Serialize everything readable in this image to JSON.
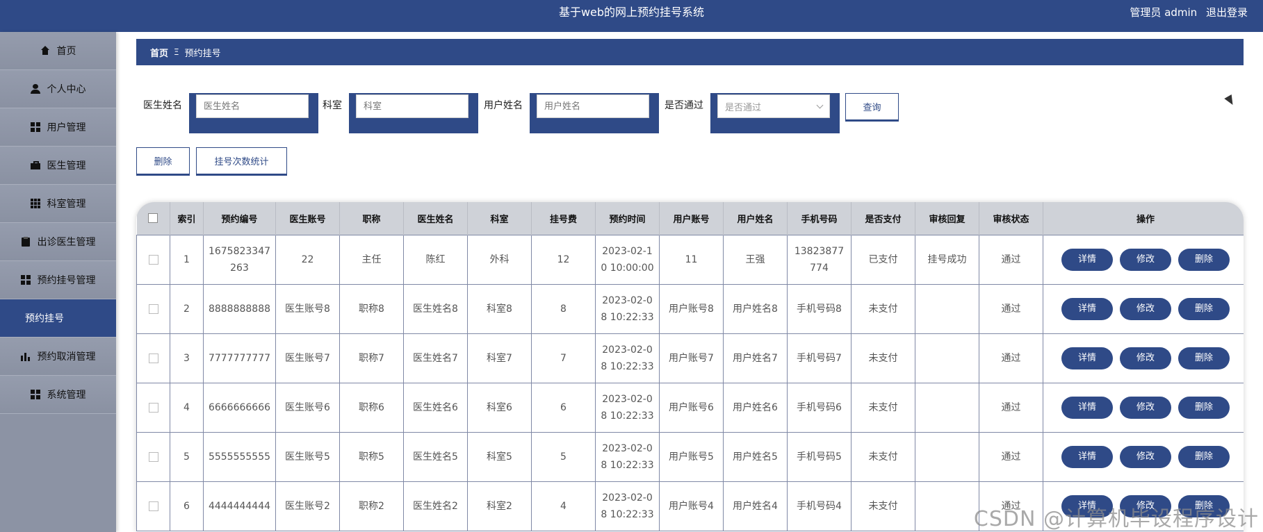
{
  "app": {
    "title": "基于web的网上预约挂号系统",
    "user_label": "管理员 admin",
    "logout": "退出登录"
  },
  "colors": {
    "primary": "#2f4a87",
    "sidebar": "#8c93a4"
  },
  "sidebar": {
    "items": [
      {
        "label": "首页",
        "icon": "home-icon"
      },
      {
        "label": "个人中心",
        "icon": "user-icon"
      },
      {
        "label": "用户管理",
        "icon": "grid-icon"
      },
      {
        "label": "医生管理",
        "icon": "briefcase-icon"
      },
      {
        "label": "科室管理",
        "icon": "grid9-icon"
      },
      {
        "label": "出诊医生管理",
        "icon": "clipboard-icon"
      },
      {
        "label": "预约挂号管理",
        "icon": "grid-icon"
      },
      {
        "label": "预约挂号",
        "active": true
      },
      {
        "label": "预约取消管理",
        "icon": "bar-chart-icon"
      },
      {
        "label": "系统管理",
        "icon": "grid-icon"
      }
    ]
  },
  "breadcrumb": {
    "home": "首页",
    "separator": "Ξ",
    "current": "预约挂号"
  },
  "search": {
    "doctor_name_label": "医生姓名",
    "doctor_name_placeholder": "医生姓名",
    "dept_label": "科室",
    "dept_placeholder": "科室",
    "user_name_label": "用户姓名",
    "user_name_placeholder": "用户姓名",
    "passed_label": "是否通过",
    "passed_placeholder": "是否通过",
    "query_button": "查询"
  },
  "actions": {
    "delete": "删除",
    "stats": "挂号次数统计"
  },
  "table": {
    "headers": [
      "索引",
      "预约编号",
      "医生账号",
      "职称",
      "医生姓名",
      "科室",
      "挂号费",
      "预约时间",
      "用户账号",
      "用户姓名",
      "手机号码",
      "是否支付",
      "审核回复",
      "审核状态",
      "操作"
    ],
    "row_buttons": {
      "detail": "详情",
      "edit": "修改",
      "delete": "删除"
    },
    "rows": [
      [
        "1",
        "1675823347263",
        "22",
        "主任",
        "陈红",
        "外科",
        "12",
        "2023-02-10 10:00:00",
        "11",
        "王强",
        "13823877774",
        "已支付",
        "挂号成功",
        "通过"
      ],
      [
        "2",
        "8888888888",
        "医生账号8",
        "职称8",
        "医生姓名8",
        "科室8",
        "8",
        "2023-02-08 10:22:33",
        "用户账号8",
        "用户姓名8",
        "手机号码8",
        "未支付",
        "",
        "通过"
      ],
      [
        "3",
        "7777777777",
        "医生账号7",
        "职称7",
        "医生姓名7",
        "科室7",
        "7",
        "2023-02-08 10:22:33",
        "用户账号7",
        "用户姓名7",
        "手机号码7",
        "未支付",
        "",
        "通过"
      ],
      [
        "4",
        "6666666666",
        "医生账号6",
        "职称6",
        "医生姓名6",
        "科室6",
        "6",
        "2023-02-08 10:22:33",
        "用户账号6",
        "用户姓名6",
        "手机号码6",
        "未支付",
        "",
        "通过"
      ],
      [
        "5",
        "5555555555",
        "医生账号5",
        "职称5",
        "医生姓名5",
        "科室5",
        "5",
        "2023-02-08 10:22:33",
        "用户账号5",
        "用户姓名5",
        "手机号码5",
        "未支付",
        "",
        "通过"
      ],
      [
        "6",
        "4444444444",
        "医生账号2",
        "职称2",
        "医生姓名2",
        "科室2",
        "4",
        "2023-02-08 10:22:33",
        "用户账号4",
        "用户姓名4",
        "手机号码4",
        "未支付",
        "",
        "通过"
      ]
    ]
  },
  "watermark": "CSDN @计算机毕设程序设计"
}
